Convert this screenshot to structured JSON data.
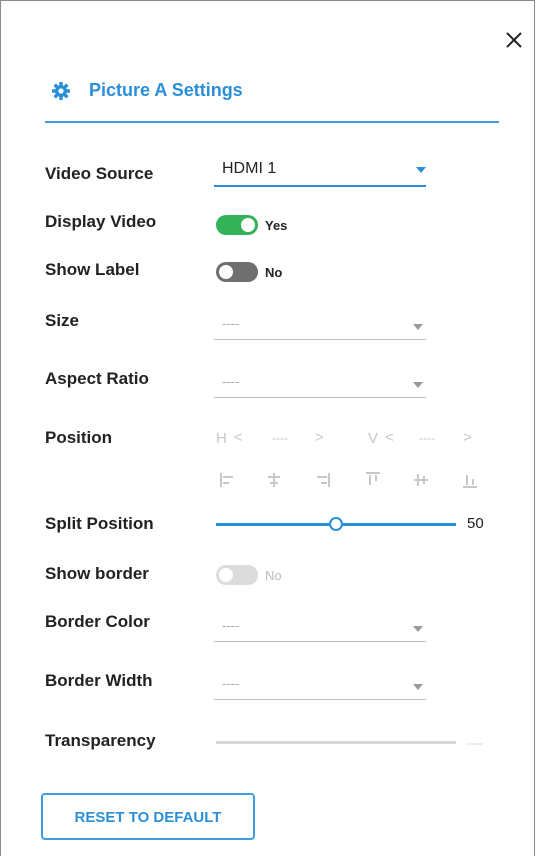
{
  "panel": {
    "title": "Picture A Settings",
    "icon": "gear-icon",
    "close_icon": "close-icon"
  },
  "colors": {
    "accent": "#2b8fd8",
    "toggle_on": "#34b25a",
    "toggle_off": "#6f6f6f",
    "toggle_disabled": "#dcdcdc"
  },
  "fields": {
    "video_source": {
      "label": "Video Source",
      "value": "HDMI 1"
    },
    "display_video": {
      "label": "Display Video",
      "state": "Yes"
    },
    "show_label": {
      "label": "Show Label",
      "state": "No"
    },
    "size": {
      "label": "Size",
      "value": "----"
    },
    "aspect_ratio": {
      "label": "Aspect Ratio",
      "value": "----"
    },
    "position": {
      "label": "Position",
      "h_label": "H",
      "h_value": "----",
      "v_label": "V",
      "v_value": "----",
      "align_icons": [
        "align-left-icon",
        "align-center-h-icon",
        "align-right-icon",
        "align-top-icon",
        "align-center-v-icon",
        "align-bottom-icon"
      ]
    },
    "split_position": {
      "label": "Split Position",
      "value": "50",
      "fraction": 0.5
    },
    "show_border": {
      "label": "Show border",
      "state": "No"
    },
    "border_color": {
      "label": "Border Color",
      "value": "----"
    },
    "border_width": {
      "label": "Border Width",
      "value": "----"
    },
    "transparency": {
      "label": "Transparency",
      "value": "----"
    }
  },
  "reset_button": "RESET TO DEFAULT"
}
